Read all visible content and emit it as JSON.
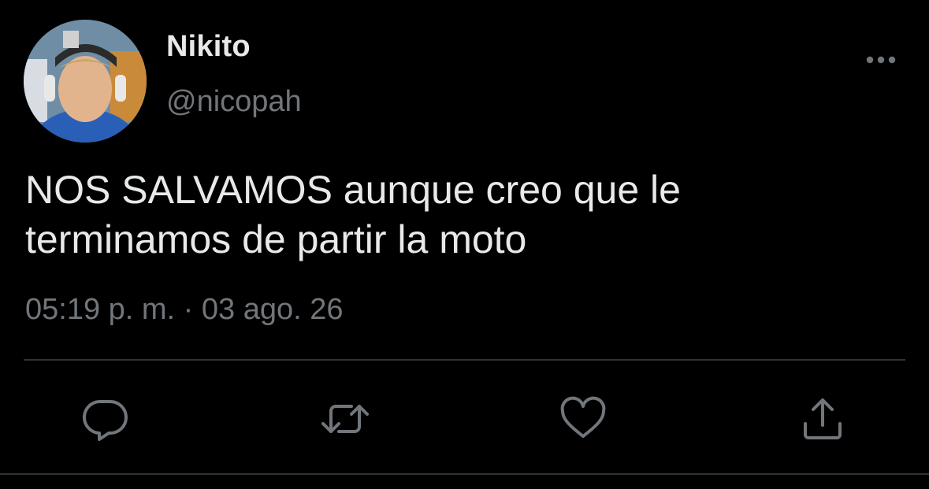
{
  "user": {
    "display_name": "Nikito",
    "handle": "@nicopah",
    "avatar_icon": "profile-photo"
  },
  "tweet": {
    "text": "NOS SALVAMOS aunque creo que le\nterminamos de partir la moto"
  },
  "meta": {
    "time": "05:19 p. m.",
    "separator": " · ",
    "date": "03 ago. 26"
  },
  "actions": [
    {
      "name": "reply",
      "icon": "reply-icon"
    },
    {
      "name": "retweet",
      "icon": "retweet-icon"
    },
    {
      "name": "like",
      "icon": "heart-icon"
    },
    {
      "name": "share",
      "icon": "share-icon"
    }
  ],
  "colors": {
    "background": "#000000",
    "primary_text": "#e7e9ea",
    "secondary_text": "#71767b",
    "divider": "#2f3336"
  }
}
